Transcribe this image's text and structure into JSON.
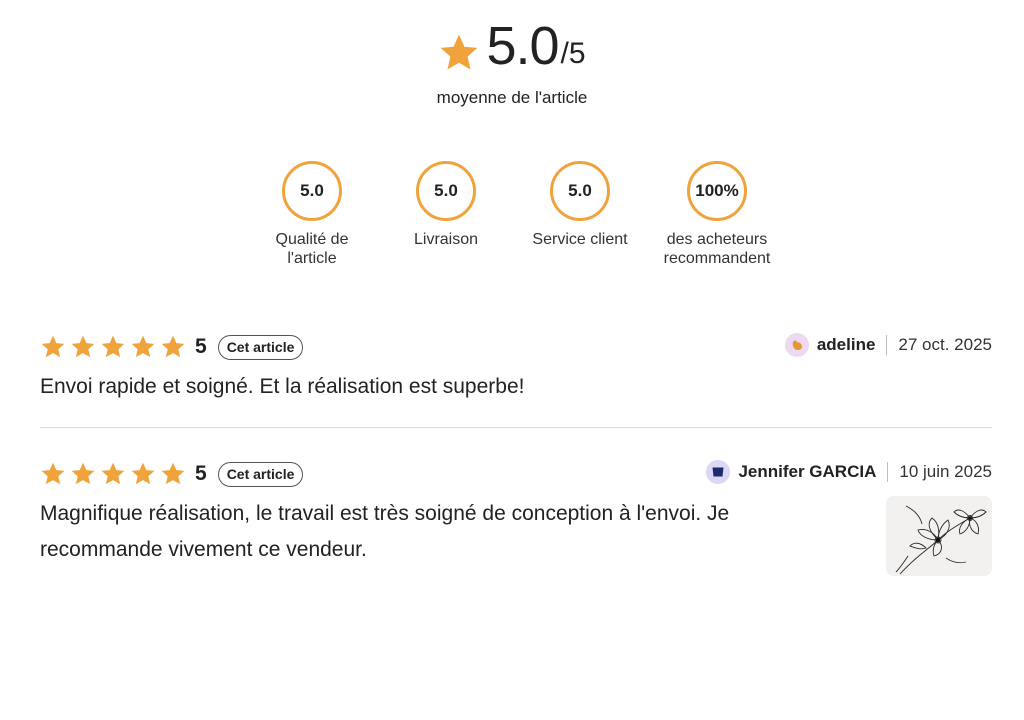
{
  "summary": {
    "average": "5.0",
    "max": "/5",
    "caption": "moyenne de l'article",
    "metrics": [
      {
        "value": "5.0",
        "label": "Qualité de l'article"
      },
      {
        "value": "5.0",
        "label": "Livraison"
      },
      {
        "value": "5.0",
        "label": "Service client"
      },
      {
        "value": "100%",
        "label": "des acheteurs recommandent"
      }
    ]
  },
  "colors": {
    "accent": "#f0a23b",
    "star": "#f0a23b"
  },
  "reviews": [
    {
      "stars": 5,
      "rating": "5",
      "badge": "Cet article",
      "user": "adeline",
      "date": "27 oct. 2025",
      "text": "Envoi rapide et soigné. Et la réalisation est superbe!",
      "avatar_icon": "fruit-avatar-icon"
    },
    {
      "stars": 5,
      "rating": "5",
      "badge": "Cet article",
      "user": "Jennifer GARCIA",
      "date": "10 juin 2025",
      "text": "Magnifique réalisation, le travail est très soigné de conception à l'envoi. Je recommande vivement ce vendeur.",
      "avatar_icon": "cup-avatar-icon",
      "photo_icon": "wire-flower-artwork-photo"
    }
  ]
}
